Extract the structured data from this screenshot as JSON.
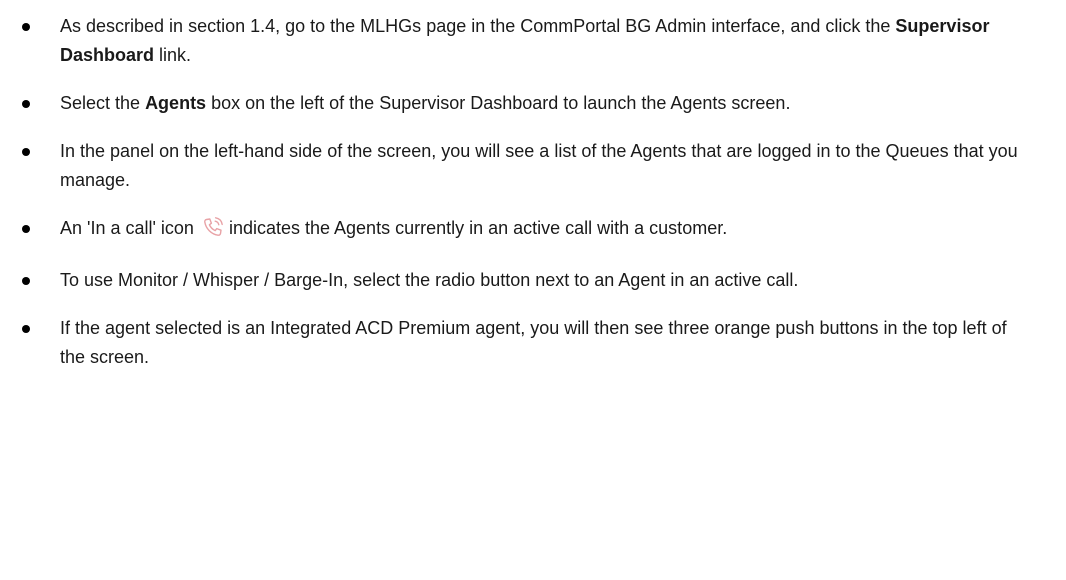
{
  "instructions": [
    {
      "before": "As described in section 1.4, go to the MLHGs page in the CommPortal BG Admin interface, and click the ",
      "bold": "Supervisor Dashboard",
      "after": " link."
    },
    {
      "before": "Select the ",
      "bold": "Agents",
      "after": " box on the left of the Supervisor Dashboard to launch the Agents screen."
    },
    {
      "text": "In the panel on the left-hand side of the screen, you will see a list of the Agents that are logged in to the Queues that you manage."
    },
    {
      "before": "An 'In a call' icon",
      "after": "indicates the Agents currently in an active call with a customer.",
      "icon": "in-call-phone-icon",
      "icon_color": "#e8a2a6"
    },
    {
      "text": "To use Monitor / Whisper / Barge-In, select the radio button next to an Agent in an active call."
    },
    {
      "text": "If the agent selected is an Integrated ACD Premium agent, you will then see three orange push buttons in the top left of the screen."
    }
  ]
}
